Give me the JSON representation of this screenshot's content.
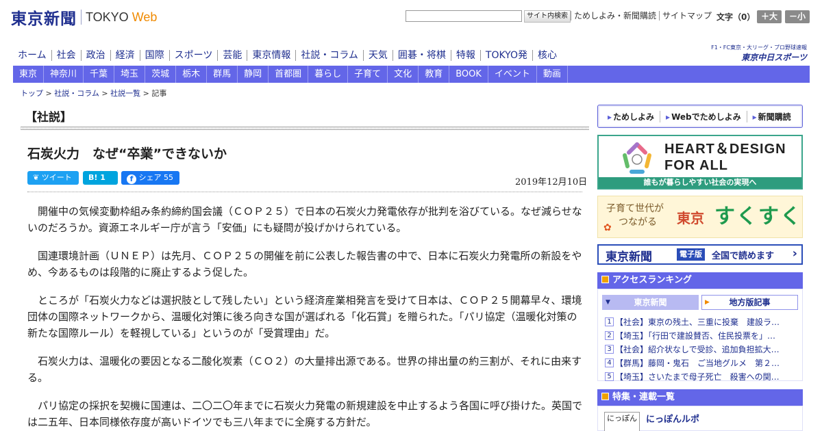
{
  "header": {
    "logo_jp": "東京新聞",
    "logo_tokyo": "TOKYO",
    "logo_web": "Web",
    "search_button": "サイト内検索",
    "links": [
      "ためしよみ・新聞購読",
      "サイトマップ"
    ],
    "font_size_label": "文字（0）",
    "font_larger": "＋大",
    "font_smaller": "－小"
  },
  "nav_main": [
    "ホーム",
    "社会",
    "政治",
    "経済",
    "国際",
    "スポーツ",
    "芸能",
    "東京情報",
    "社説・コラム",
    "天気",
    "囲碁・将棋",
    "特報",
    "TOKYO発",
    "核心"
  ],
  "chunichi": {
    "sub": "F1・FC東京・大リーグ・プロ野球速報",
    "main": "東京中日スポーツ"
  },
  "nav_regional": [
    "東京",
    "神奈川",
    "千葉",
    "埼玉",
    "茨城",
    "栃木",
    "群馬",
    "静岡",
    "首都圏",
    "暮らし",
    "子育て",
    "文化",
    "教育",
    "BOOK",
    "イベント",
    "動画"
  ],
  "breadcrumb": {
    "items": [
      "トップ",
      "社説・コラム",
      "社説一覧"
    ],
    "current": "記事",
    "sep": " > "
  },
  "article": {
    "section": "【社説】",
    "title": "石炭火力　なぜ“卒業”できないか",
    "date": "2019年12月10日",
    "share": {
      "tweet": "ツイート",
      "hatena": "1",
      "facebook": "シェア 55"
    },
    "paragraphs": [
      "開催中の気候変動枠組み条約締約国会議（ＣＯＰ２５）で日本の石炭火力発電依存が批判を浴びている。なぜ減らせないのだろうか。資源エネルギー庁が言う「安価」にも疑問が投げかけられている。",
      "国連環境計画（ＵＮＥＰ）は先月、ＣＯＰ２５の開催を前に公表した報告書の中で、日本に石炭火力発電所の新設をやめ、今あるものは段階的に廃止するよう促した。",
      "ところが「石炭火力などは選択肢として残したい」という経済産業相発言を受けて日本は、ＣＯＰ２５開幕早々、環境団体の国際ネットワークから、温暖化対策に後ろ向きな国が選ばれる「化石賞」を贈られた。「パリ協定（温暖化対策の新たな国際ルール）を軽視している」というのが「受賞理由」だ。",
      "石炭火力は、温暖化の要因となる二酸化炭素（ＣＯ２）の大量排出源である。世界の排出量の約三割が、それに由来する。",
      "パリ協定の採択を契機に国連は、二〇二〇年までに石炭火力発電の新規建設を中止するよう各国に呼び掛けた。英国では二五年、日本同様依存度が高いドイツでも三八年までに全廃する方針だ。"
    ]
  },
  "sidebar": {
    "tabs": [
      "ためしよみ",
      "Webでためしよみ",
      "新聞購読"
    ],
    "hd_banner": {
      "title_line1": "HEART＆DESIGN",
      "title_line2": "FOR ALL",
      "footer": "誰もが暮らしやすい社会の実現へ"
    },
    "sukusuku": {
      "sub_line1": "子育て世代が",
      "sub_line2": "つながる",
      "tokyo": "東京",
      "main": "すくすく"
    },
    "epaper": {
      "logo": "東京新聞",
      "badge": "電子版",
      "text": "全国で読めます",
      "arrow": "›"
    },
    "ranking": {
      "title": "アクセスランキング",
      "tab_active": "東京新聞",
      "tab_inactive": "地方版記事",
      "items": [
        {
          "num": "1",
          "text": "【社会】東京の残土、三重に投棄　建設ラ…"
        },
        {
          "num": "2",
          "text": "【埼玉】「行田で建設賛否、住民投票を」…"
        },
        {
          "num": "3",
          "text": "【社会】紹介状なしで受診、追加負担拡大…"
        },
        {
          "num": "4",
          "text": "【群馬】藤岡・鬼石　ご当地グルメ　第２…"
        },
        {
          "num": "5",
          "text": "【埼玉】さいたまで母子死亡　殺害への関…"
        }
      ]
    },
    "features": {
      "title": "特集・連載一覧",
      "thumb": "にっぽん",
      "item": "にっぽんルポ"
    }
  },
  "colors": {
    "brand_navy": "#1f2f8f",
    "nav_blue": "#6366e8",
    "web_orange": "#f08a00",
    "hd_green": "#2e9c7e"
  }
}
